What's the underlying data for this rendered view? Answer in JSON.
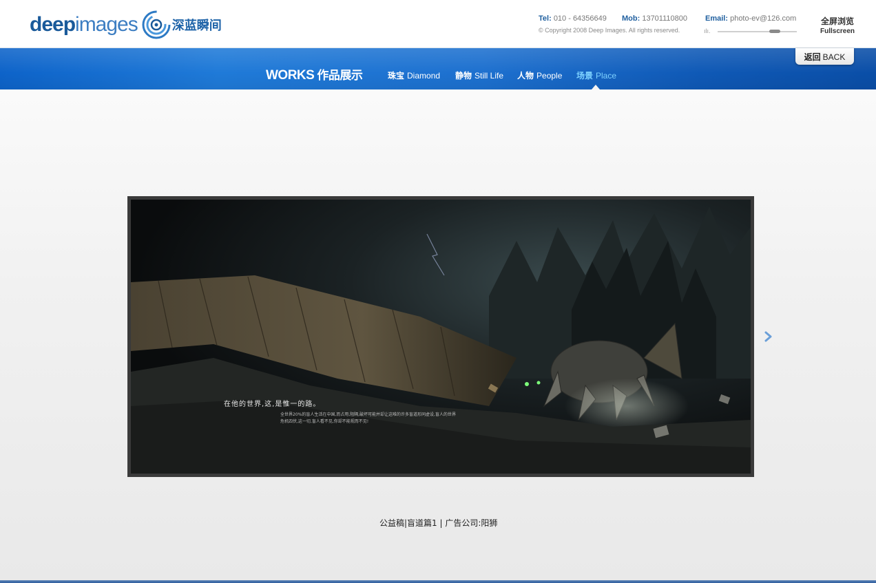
{
  "header": {
    "logo": {
      "part1": "deep",
      "part2": "images",
      "cn": "深蓝瞬间"
    },
    "tel_label": "Tel:",
    "tel": "010 - 64356649",
    "mob_label": "Mob:",
    "mob": "13701110800",
    "email_label": "Email:",
    "email": "photo-ev@126.com",
    "copyright": "© Copyright 2008 Deep Images. All rights reserved.",
    "volume_level": 0.76,
    "fullscreen_cn": "全屏浏览",
    "fullscreen_en": "Fullscreen"
  },
  "nav": {
    "title_en": "WORKS",
    "title_cn": "作品展示",
    "items": [
      {
        "cn": "珠宝",
        "en": "Diamond"
      },
      {
        "cn": "静物",
        "en": "Still Life"
      },
      {
        "cn": "人物",
        "en": "People"
      },
      {
        "cn": "场景",
        "en": "Place"
      }
    ],
    "active": "Place",
    "back_cn": "返回",
    "back_en": "BACK"
  },
  "photo": {
    "headline": "在他的世界,这,是惟一的路。",
    "body": "全世界20%的盲人生活在中国,而占用,阻隔,破坏可能并却让这唯的许多盲道形同虚设,盲人的世界危机四伏,这一切,盲人看不见,你却不能视而不见!",
    "caption": "公益稿|盲道篇1 | 广告公司:阳狮"
  },
  "colors": {
    "brand": "#1a5a9a",
    "nav_active": "#7ed2ff",
    "nav_bg": "#1d70cf"
  },
  "icons": {
    "next": "chevron-right-icon",
    "volume": "volume-icon"
  }
}
